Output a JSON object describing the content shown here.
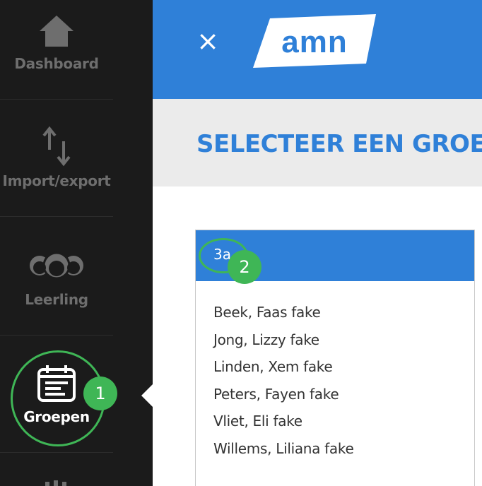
{
  "sidebar": {
    "items": [
      {
        "label": "Dashboard",
        "icon": "home-icon"
      },
      {
        "label": "Import/export",
        "icon": "import-export-icon"
      },
      {
        "label": "Leerling",
        "icon": "students-icon"
      },
      {
        "label": "Groepen",
        "icon": "calendar-icon",
        "active": true
      }
    ]
  },
  "badges": {
    "step1": "1",
    "step2": "2"
  },
  "header": {
    "close_label": "×",
    "logo_text": "amn"
  },
  "page_title": "SELECTEER EEN GROEP",
  "group": {
    "name": "3a",
    "students": [
      "Beek, Faas fake",
      "Jong, Lizzy fake",
      "Linden, Xem fake",
      "Peters, Fayen fake",
      "Vliet, Eli fake",
      "Willems, Liliana fake"
    ]
  },
  "colors": {
    "sidebar": "#1b1b1b",
    "accent": "#2f80d8",
    "highlight": "#3fb656"
  }
}
